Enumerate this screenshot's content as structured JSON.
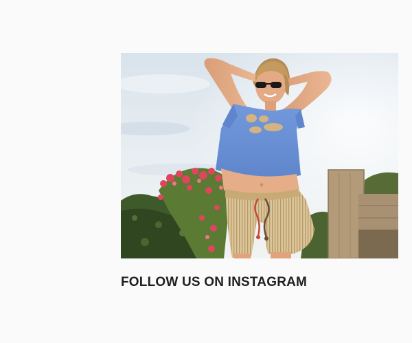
{
  "instagram": {
    "heading": "FOLLOW US ON INSTAGRAM",
    "photo_alt": "Woman in blue crop tee and striped shorts outdoors",
    "link_url": ""
  },
  "colors": {
    "page_background": "#fafafa",
    "heading_text": "#1f1f1f",
    "tee_blue": "#6c93d8",
    "shorts_tan": "#d8c194",
    "flowers_pink": "#e0455e",
    "foliage_green": "#3f5a2a"
  }
}
